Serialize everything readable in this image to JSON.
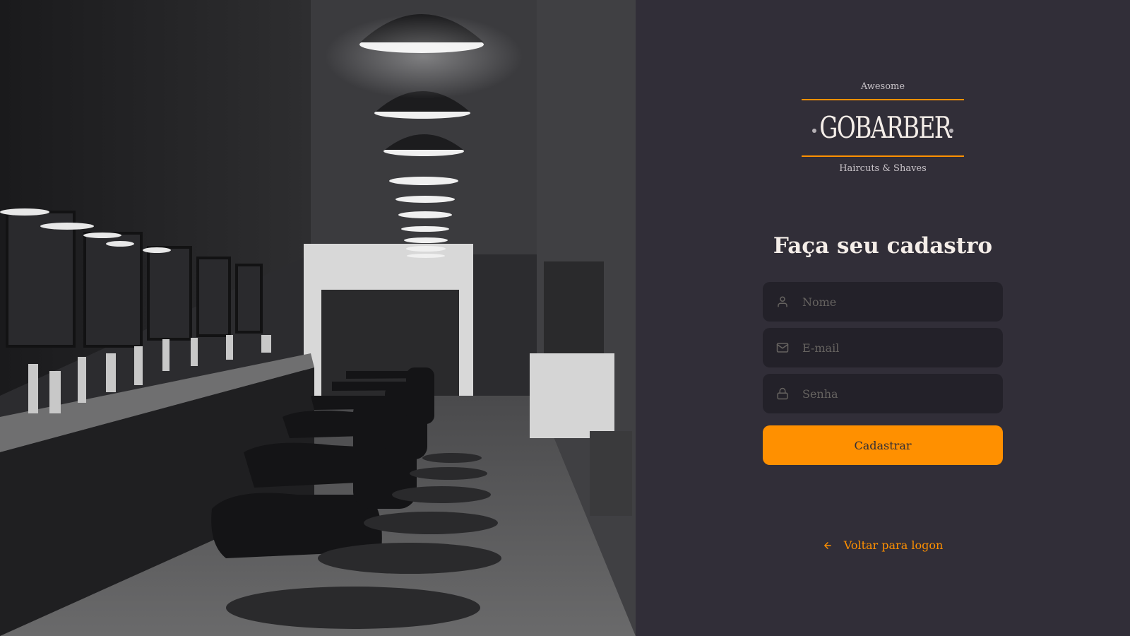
{
  "brand": {
    "top_text": "Awesome",
    "name": "GOBARBER",
    "tagline": "Haircuts & Shaves",
    "accent_color": "#ff9000"
  },
  "hero_image": {
    "icon": "barbershop-photo"
  },
  "form": {
    "title": "Faça seu cadastro",
    "fields": [
      {
        "icon": "user-icon",
        "placeholder": "Nome",
        "value": ""
      },
      {
        "icon": "mail-icon",
        "placeholder": "E-mail",
        "value": ""
      },
      {
        "icon": "lock-icon",
        "placeholder": "Senha",
        "value": ""
      }
    ],
    "submit_label": "Cadastrar"
  },
  "back_link": {
    "icon": "arrow-left-icon",
    "label": "Voltar para logon"
  },
  "colors": {
    "background": "#312e38",
    "input_background": "#232129",
    "placeholder": "#666360",
    "text": "#f4ede8"
  }
}
